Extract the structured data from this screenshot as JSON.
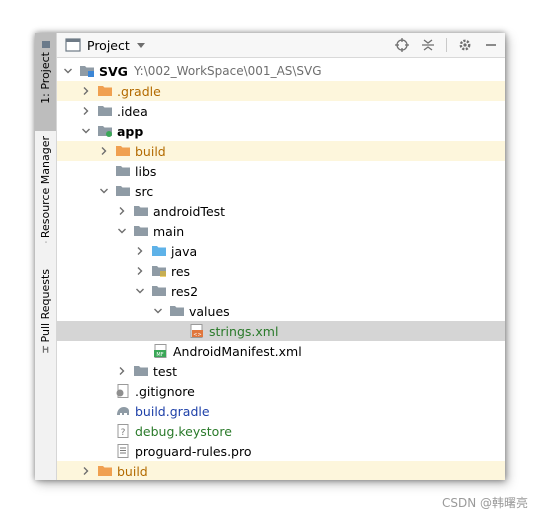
{
  "sidebar": {
    "tabs": [
      {
        "label": "1: Project"
      },
      {
        "label": "Resource Manager"
      },
      {
        "label": "Pull Requests"
      }
    ]
  },
  "header": {
    "title": "Project"
  },
  "tree": {
    "rows": [
      {
        "label": "SVG",
        "path": "Y:\\002_WorkSpace\\001_AS\\SVG"
      },
      {
        "label": ".gradle"
      },
      {
        "label": ".idea"
      },
      {
        "label": "app"
      },
      {
        "label": "build"
      },
      {
        "label": "libs"
      },
      {
        "label": "src"
      },
      {
        "label": "androidTest"
      },
      {
        "label": "main"
      },
      {
        "label": "java"
      },
      {
        "label": "res"
      },
      {
        "label": "res2"
      },
      {
        "label": "values"
      },
      {
        "label": "strings.xml"
      },
      {
        "label": "AndroidManifest.xml"
      },
      {
        "label": "test"
      },
      {
        "label": ".gitignore"
      },
      {
        "label": "build.gradle"
      },
      {
        "label": "debug.keystore"
      },
      {
        "label": "proguard-rules.pro"
      },
      {
        "label": "build"
      }
    ]
  },
  "watermark": "CSDN @韩曙亮",
  "colors": {
    "excluded_highlight": "#fdf6dc",
    "selection": "#d5d5d5",
    "folder_gray": "#8f9ba5",
    "folder_orange": "#f0a050",
    "folder_blue": "#5eb2e8"
  }
}
